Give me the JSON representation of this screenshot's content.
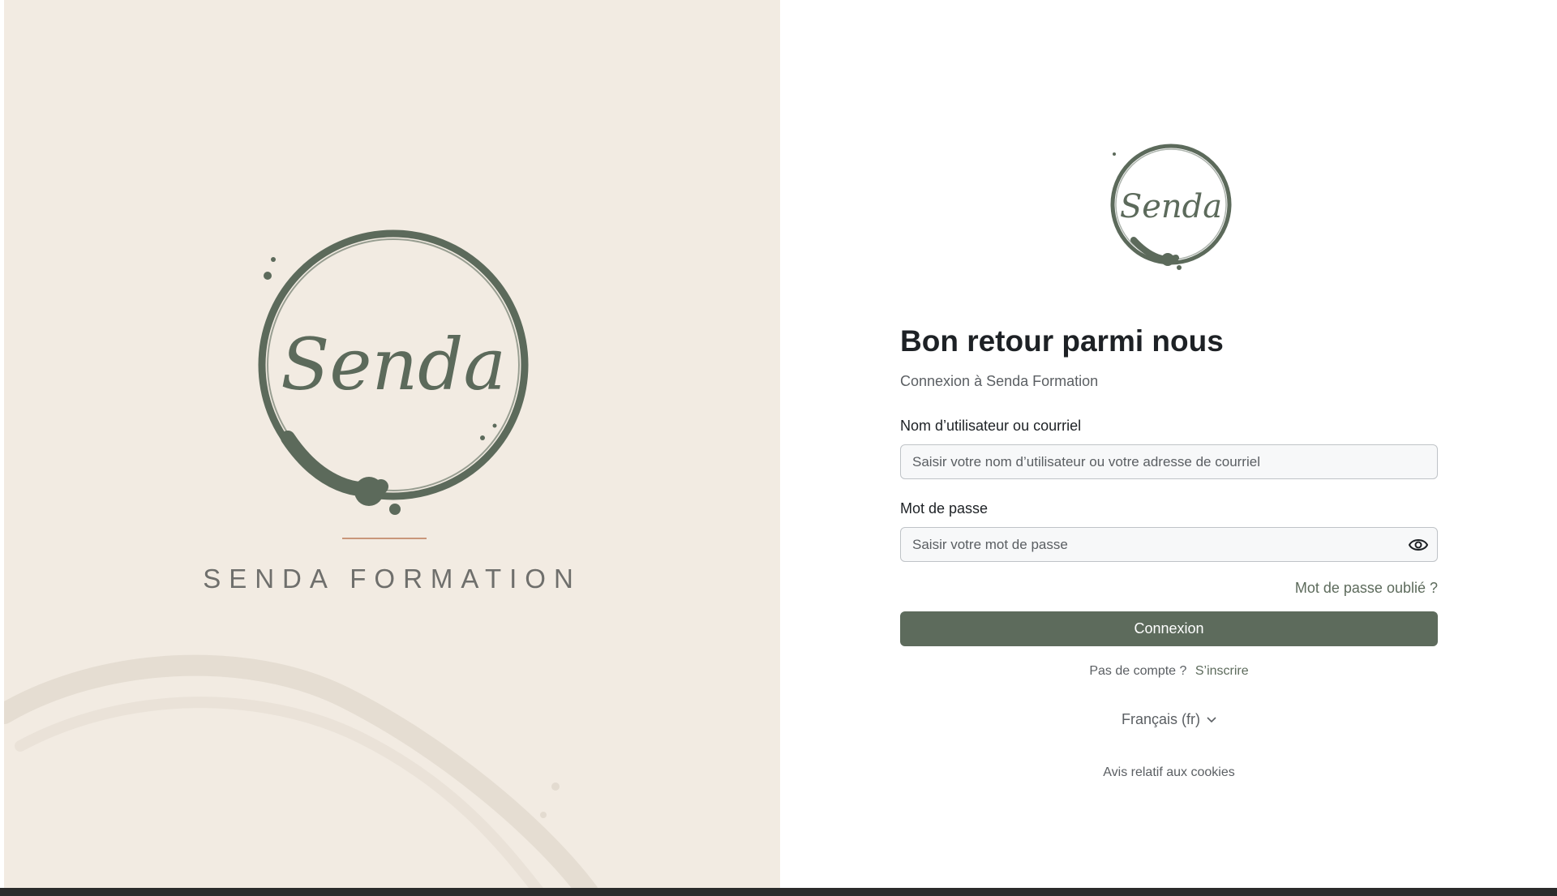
{
  "brand": {
    "logo_text": "Senda",
    "name": "SENDA FORMATION"
  },
  "colors": {
    "panel_background": "#f2ebe2",
    "accent": "#5d6b5c",
    "rule": "#c9967a"
  },
  "icons": {
    "password_toggle": "eye-icon",
    "language_dropdown": "chevron-down-icon"
  },
  "login": {
    "title": "Bon retour parmi nous",
    "subtitle": "Connexion à Senda Formation",
    "username_label": "Nom d’utilisateur ou courriel",
    "username_placeholder": "Saisir votre nom d’utilisateur ou votre adresse de courriel",
    "username_value": "",
    "password_label": "Mot de passe",
    "password_placeholder": "Saisir votre mot de passe",
    "password_value": "",
    "forgot_password": "Mot de passe oublié ?",
    "submit_label": "Connexion",
    "no_account": "Pas de compte ?",
    "signup": "S’inscrire",
    "language": "Français (fr)",
    "cookies": "Avis relatif aux cookies"
  }
}
